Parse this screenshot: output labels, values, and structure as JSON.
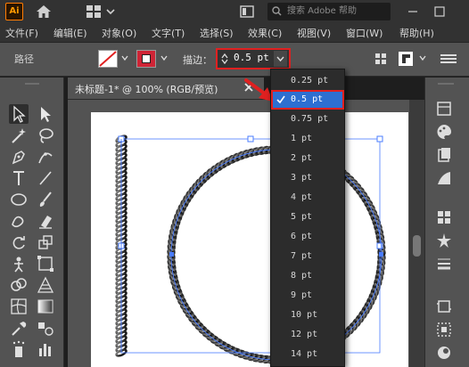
{
  "app": {
    "logo": "Ai",
    "search_placeholder": "搜索 Adobe 帮助",
    "search_icon": "search-icon",
    "home_icon": "home-icon"
  },
  "menu": [
    "文件(F)",
    "编辑(E)",
    "对象(O)",
    "文字(T)",
    "选择(S)",
    "效果(C)",
    "视图(V)",
    "窗口(W)",
    "帮助(H)"
  ],
  "control": {
    "object_type": "路径",
    "stroke_label": "描边：",
    "stroke_value": "0.5 pt"
  },
  "document": {
    "tab_title": "未标题-1* @ 100% (RGB/预览)"
  },
  "stroke_dropdown": {
    "options": [
      "0.25 pt",
      "0.5 pt",
      "0.75 pt",
      "1 pt",
      "2 pt",
      "3 pt",
      "4 pt",
      "5 pt",
      "6 pt",
      "7 pt",
      "8 pt",
      "9 pt",
      "10 pt",
      "12 pt",
      "14 pt"
    ],
    "selected": "0.5 pt"
  },
  "colors": {
    "highlight_red": "#e02020",
    "selection_blue": "#2d6fd1",
    "panel_bg": "#535353"
  }
}
